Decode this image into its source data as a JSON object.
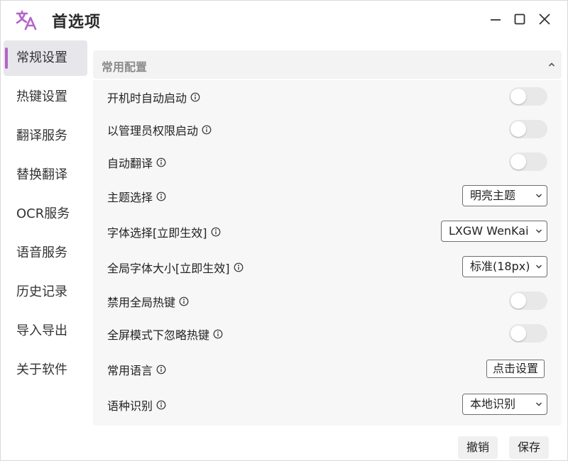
{
  "window": {
    "title": "首选项",
    "accent_color": "#b464c8"
  },
  "sidebar": {
    "items": [
      {
        "label": "常规设置",
        "active": true
      },
      {
        "label": "热键设置"
      },
      {
        "label": "翻译服务"
      },
      {
        "label": "替换翻译"
      },
      {
        "label": "OCR服务"
      },
      {
        "label": "语音服务"
      },
      {
        "label": "历史记录"
      },
      {
        "label": "导入导出"
      },
      {
        "label": "关于软件"
      }
    ]
  },
  "section": {
    "title": "常用配置"
  },
  "settings": {
    "auto_start": {
      "label": "开机时自动启动",
      "enabled": false
    },
    "admin_start": {
      "label": "以管理员权限启动",
      "enabled": false
    },
    "auto_translate": {
      "label": "自动翻译",
      "enabled": false
    },
    "theme": {
      "label": "主题选择",
      "value": "明亮主题"
    },
    "font": {
      "label": "字体选择[立即生效]",
      "value": "LXGW WenKai"
    },
    "font_size": {
      "label": "全局字体大小[立即生效]",
      "value": "标准(18px)"
    },
    "disable_hotkeys": {
      "label": "禁用全局热键",
      "enabled": false
    },
    "fullscreen_ignore_hotkeys": {
      "label": "全屏模式下忽略热键",
      "enabled": false
    },
    "common_languages": {
      "label": "常用语言",
      "button": "点击设置"
    },
    "language_detection": {
      "label": "语种识别",
      "value": "本地识别"
    }
  },
  "footer": {
    "cancel": "撤销",
    "save": "保存"
  }
}
